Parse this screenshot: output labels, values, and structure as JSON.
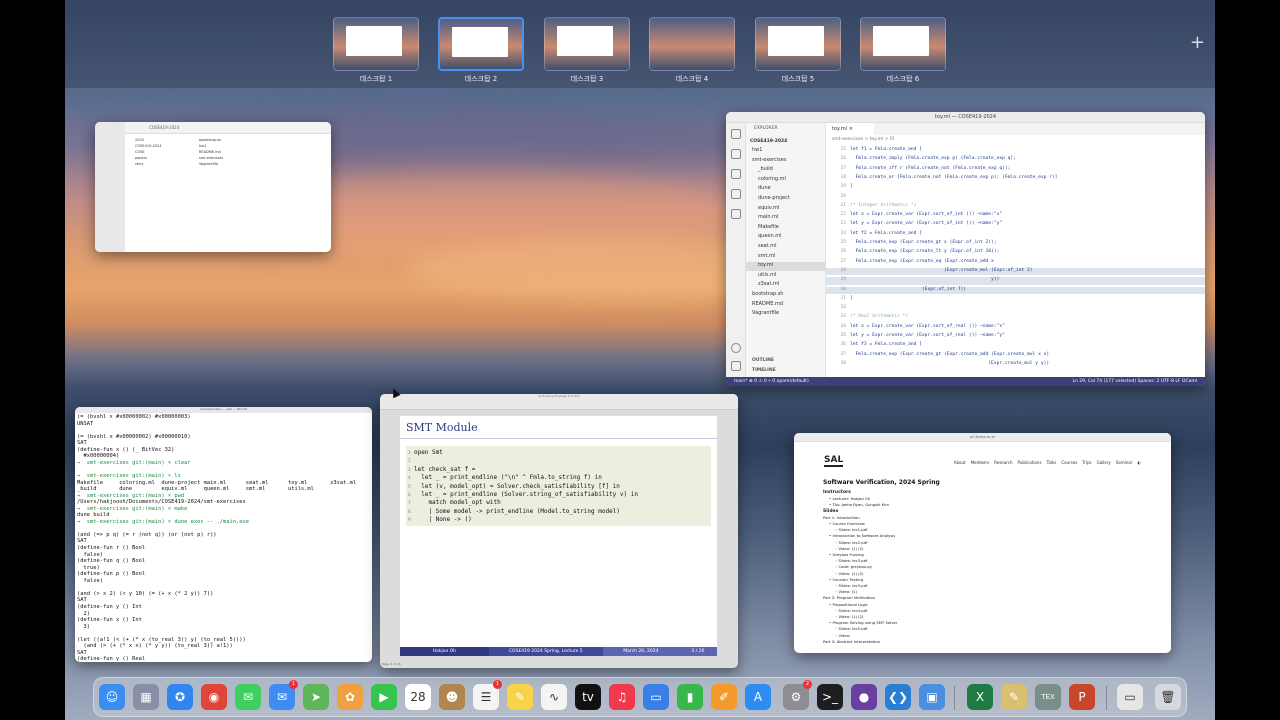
{
  "spaces": [
    {
      "label": "데스크탑 1",
      "active": false
    },
    {
      "label": "데스크탑 2",
      "active": true
    },
    {
      "label": "데스크탑 3",
      "active": false
    },
    {
      "label": "데스크탑 4",
      "active": false
    },
    {
      "label": "데스크탑 5",
      "active": false
    },
    {
      "label": "데스크탑 6",
      "active": false
    }
  ],
  "add_space": "+",
  "finder": {
    "title": "COSE419-2024",
    "items_left": [
      "2024",
      "COSE419-2024",
      "COSE",
      "papers",
      "retry"
    ],
    "items_right": [
      "bootstrap.sh",
      "hw1",
      "README.md",
      "smt-exercises",
      "Vagrantfile"
    ]
  },
  "vscode": {
    "title": "toy.ml — COSE419-2024",
    "explorer_header": "EXPLORER",
    "root": "COSE419-2024",
    "tree": [
      "hw1",
      "smt-exercises",
      "_build",
      "coloring.ml",
      "dune",
      "dune-project",
      "equiv.ml",
      "main.ml",
      "Makefile",
      "queen.ml",
      "seat.ml",
      "smt.ml",
      "toy.ml",
      "utils.ml",
      "z3sat.ml",
      "bootstrap.sh",
      "README.md",
      "Vagrantfile"
    ],
    "tab": "toy.ml",
    "crumb": "smt-exercises > toy.ml > f2",
    "outline": "OUTLINE",
    "timeline": "TIMELINE",
    "code": [
      {
        "n": "15",
        "t": "let f1 = Fmla.create_and [",
        "c": false,
        "h": false
      },
      {
        "n": "16",
        "t": "  Fmla.create_imply (Fmla.create_exp p) (Fmla.create_exp q);",
        "c": false,
        "h": false
      },
      {
        "n": "17",
        "t": "  Fmla.create_iff r (Fmla.create_not (Fmla.create_exp q));",
        "c": false,
        "h": false
      },
      {
        "n": "18",
        "t": "  Fmla.create_or [Fmla.create_not (Fmla.create_exp p); (Fmla.create_exp r)]",
        "c": false,
        "h": false
      },
      {
        "n": "19",
        "t": "]",
        "c": false,
        "h": false
      },
      {
        "n": "20",
        "t": "",
        "c": false,
        "h": false
      },
      {
        "n": "21",
        "t": "(* Integer Arithmetic *)",
        "c": true,
        "h": false
      },
      {
        "n": "22",
        "t": "let x = Expr.create_var (Expr.sort_of_int ()) ~name:\"x\"",
        "c": false,
        "h": false
      },
      {
        "n": "23",
        "t": "let y = Expr.create_var (Expr.sort_of_int ()) ~name:\"y\"",
        "c": false,
        "h": false
      },
      {
        "n": "24",
        "t": "let f2 = Fmla.create_and [",
        "c": false,
        "h": false
      },
      {
        "n": "25",
        "t": "  Fmla.create_exp (Expr.create_gt x (Expr.of_int 2));",
        "c": false,
        "h": false
      },
      {
        "n": "26",
        "t": "  Fmla.create_exp (Expr.create_lt y (Expr.of_int 10));",
        "c": false,
        "h": false
      },
      {
        "n": "27",
        "t": "  Fmla.create_exp (Expr.create_eq (Expr.create_add x",
        "c": false,
        "h": false
      },
      {
        "n": "28",
        "t": "                                  (Expr.create_mul (Expr.of_int 2)",
        "c": false,
        "h": true
      },
      {
        "n": "29",
        "t": "                                                   y))",
        "c": false,
        "h": true
      },
      {
        "n": "30",
        "t": "                          (Expr.of_int 7))",
        "c": false,
        "h": true
      },
      {
        "n": "31",
        "t": "]",
        "c": false,
        "h": false
      },
      {
        "n": "32",
        "t": "",
        "c": false,
        "h": false
      },
      {
        "n": "33",
        "t": "(* Real Arithmetic *)",
        "c": true,
        "h": false
      },
      {
        "n": "34",
        "t": "let x = Expr.create_var (Expr.sort_of_real ()) ~name:\"x\"",
        "c": false,
        "h": false
      },
      {
        "n": "35",
        "t": "let y = Expr.create_var (Expr.sort_of_real ()) ~name:\"y\"",
        "c": false,
        "h": false
      },
      {
        "n": "36",
        "t": "let f3 = Fmla.create_and [",
        "c": false,
        "h": false
      },
      {
        "n": "37",
        "t": "  Fmla.create_exp (Expr.create_gt (Expr.create_add (Expr.create_mul x x)",
        "c": false,
        "h": false
      },
      {
        "n": "38",
        "t": "                                                  (Expr.create_mul y y))",
        "c": false,
        "h": false
      }
    ],
    "status_left": "main*   ⊗ 0 ⚠ 0   ⑂ 0   opam(default)",
    "status_right": "Ln 29, Col 74 (177 selected)   Spaces: 2   UTF-8   LF   OCaml"
  },
  "terminal": {
    "title": "smt-exercises — -zsh — 80×24",
    "lines": [
      {
        "t": "(= (bvshl x #x00000002) #x00000003)",
        "p": false
      },
      {
        "t": "UNSAT",
        "p": false
      },
      {
        "t": "",
        "p": false
      },
      {
        "t": "(= (bvshl x #x00000002) #x00000010)",
        "p": false
      },
      {
        "t": "SAT",
        "p": false
      },
      {
        "t": "(define-fun x () (_ BitVec 32)",
        "p": false
      },
      {
        "t": "  #x00000004)",
        "p": false
      },
      {
        "t": "→  smt-exercises git:(main) × clear",
        "p": true
      },
      {
        "t": "",
        "p": false
      },
      {
        "t": "→  smt-exercises git:(main) × ls",
        "p": true
      },
      {
        "t": "Makefile     coloring.ml  dune-project main.ml      seat.ml      toy.ml       z3sat.ml",
        "p": false
      },
      {
        "t": "_build       dune         equiv.ml     queen.ml     smt.ml       utils.ml",
        "p": false
      },
      {
        "t": "→  smt-exercises git:(main) × pwd",
        "p": true
      },
      {
        "t": "/Users/hakjoooh/Documents/COSE419-2024/smt-exercises",
        "p": false
      },
      {
        "t": "→  smt-exercises git:(main) × make",
        "p": true
      },
      {
        "t": "dune build",
        "p": false
      },
      {
        "t": "→  smt-exercises git:(main) × dune exec -- ./main.exe",
        "p": true
      },
      {
        "t": "",
        "p": false
      },
      {
        "t": "(and (=> p q) (= r (not q)) (or (not p) r))",
        "p": false
      },
      {
        "t": "SAT",
        "p": false
      },
      {
        "t": "(define-fun r () Bool",
        "p": false
      },
      {
        "t": "  false)",
        "p": false
      },
      {
        "t": "(define-fun q () Bool",
        "p": false
      },
      {
        "t": "  true)",
        "p": false
      },
      {
        "t": "(define-fun p () Bool",
        "p": false
      },
      {
        "t": "  false)",
        "p": false
      },
      {
        "t": "",
        "p": false
      },
      {
        "t": "(and (> x 2) (< y 10) (= (+ x (* 2 y)) 7))",
        "p": false
      },
      {
        "t": "SAT",
        "p": false
      },
      {
        "t": "(define-fun y () Int",
        "p": false
      },
      {
        "t": "  2)",
        "p": false
      },
      {
        "t": "(define-fun x () Int",
        "p": false
      },
      {
        "t": "  3)",
        "p": false
      },
      {
        "t": "",
        "p": false
      },
      {
        "t": "(let ((a!1 (< (+ (* x (to_real 3)) y) (to_real 5))))",
        "p": false
      },
      {
        "t": "  (and (> (+ (* x x) (* y y)) (to_real 3)) a!1))",
        "p": false
      },
      {
        "t": "SAT",
        "p": false
      },
      {
        "t": "(define-fun y () Real",
        "p": false
      }
    ]
  },
  "preview": {
    "title": "lec5-smt.pdf (page 3 of 26)",
    "slide_title": "SMT Module",
    "code": [
      {
        "n": "1",
        "t": "open Smt"
      },
      {
        "n": "2",
        "t": ""
      },
      {
        "n": "3",
        "t": "let check_sat f ="
      },
      {
        "n": "4",
        "t": "  let _ = print_endline (\"\\n\" ^ Fmla.to_string f) in"
      },
      {
        "n": "5",
        "t": "  let (v, model_opt) = Solver.check_satisfiability [f] in"
      },
      {
        "n": "6",
        "t": "  let _ = print_endline (Solver.string_of_satisfiability v) in"
      },
      {
        "n": "7",
        "t": "    match model_opt with"
      },
      {
        "n": "8",
        "t": "    | Some model -> print_endline (Model.to_string model)"
      },
      {
        "n": "9",
        "t": "    | None -> ()"
      }
    ],
    "footer": [
      "Hakjoo Oh",
      "COSE419 2024 Spring, Lecture 5",
      "March 26, 2024",
      "3 / 26"
    ],
    "page_info": "Page 3 of 26"
  },
  "safari": {
    "url": "prl.korea.ac.kr",
    "logo": "SAL",
    "nav": [
      "About",
      "Members",
      "Research",
      "Publications",
      "Talks",
      "Courses",
      "Trips",
      "Gallery",
      "Seminar",
      "◐"
    ],
    "heading": "Software Verification, 2024 Spring",
    "lines": [
      {
        "t": "Instructors",
        "b": true,
        "i": 0
      },
      {
        "t": "• Lecturer: Hakjoo Oh",
        "b": false,
        "i": 1
      },
      {
        "t": "• TAs: Jaeho Ryan, Gungsik Kim",
        "b": false,
        "i": 1
      },
      {
        "t": "Slides",
        "b": true,
        "i": 0
      },
      {
        "t": "Part 1: Introduction",
        "b": false,
        "i": 0
      },
      {
        "t": "• Course Overview",
        "b": false,
        "i": 1
      },
      {
        "t": "◦ Slides: lec1.pdf",
        "b": false,
        "i": 2
      },
      {
        "t": "• Introduction to Software Analysis",
        "b": false,
        "i": 1
      },
      {
        "t": "◦ Slides: lec2.pdf",
        "b": false,
        "i": 2
      },
      {
        "t": "◦ Video: (1) (2)",
        "b": false,
        "i": 2
      },
      {
        "t": "• Greybox Fuzzing",
        "b": false,
        "i": 1
      },
      {
        "t": "◦ Slides: lec3.pdf",
        "b": false,
        "i": 2
      },
      {
        "t": "◦ Code: greybox.py",
        "b": false,
        "i": 2
      },
      {
        "t": "◦ Video: (1) (2)",
        "b": false,
        "i": 2
      },
      {
        "t": "• Concolic Testing",
        "b": false,
        "i": 1
      },
      {
        "t": "◦ Slides: lec3.pdf",
        "b": false,
        "i": 2
      },
      {
        "t": "◦ Video: (1)",
        "b": false,
        "i": 2
      },
      {
        "t": "Part 2: Program Verification",
        "b": false,
        "i": 0
      },
      {
        "t": "• Propositional Logic",
        "b": false,
        "i": 1
      },
      {
        "t": "◦ Slides: lec4.pdf",
        "b": false,
        "i": 2
      },
      {
        "t": "◦ Video: (1) (2)",
        "b": false,
        "i": 2
      },
      {
        "t": "• Program Solving using SMT Solver",
        "b": false,
        "i": 1
      },
      {
        "t": "◦ Slides: lec5.pdf",
        "b": false,
        "i": 2
      },
      {
        "t": "◦ Video:",
        "b": false,
        "i": 2
      },
      {
        "t": "Part 3: Abstract Interpretation",
        "b": false,
        "i": 0
      }
    ]
  },
  "dock": [
    {
      "name": "finder",
      "glyph": "☺",
      "color": "#3a8ef0",
      "badge": ""
    },
    {
      "name": "launchpad",
      "glyph": "▦",
      "color": "#8a8fa8",
      "badge": ""
    },
    {
      "name": "safari",
      "glyph": "✪",
      "color": "#2f86f0",
      "badge": ""
    },
    {
      "name": "chrome",
      "glyph": "◉",
      "color": "#e0453a",
      "badge": ""
    },
    {
      "name": "messages",
      "glyph": "✉",
      "color": "#3ecf5e",
      "badge": ""
    },
    {
      "name": "mail",
      "glyph": "✉",
      "color": "#3d8df2",
      "badge": "1"
    },
    {
      "name": "maps",
      "glyph": "➤",
      "color": "#5db65a",
      "badge": ""
    },
    {
      "name": "photos",
      "glyph": "✿",
      "color": "#f0a040",
      "badge": ""
    },
    {
      "name": "facetime",
      "glyph": "▶",
      "color": "#37c44e",
      "badge": ""
    },
    {
      "name": "calendar",
      "glyph": "28",
      "color": "#ffffff",
      "badge": ""
    },
    {
      "name": "contacts",
      "glyph": "☻",
      "color": "#b0864e",
      "badge": ""
    },
    {
      "name": "reminders",
      "glyph": "☰",
      "color": "#f4f4f4",
      "badge": "1"
    },
    {
      "name": "notes",
      "glyph": "✎",
      "color": "#f7d34a",
      "badge": ""
    },
    {
      "name": "freeform",
      "glyph": "∿",
      "color": "#f4f4f4",
      "badge": ""
    },
    {
      "name": "tv",
      "glyph": "tv",
      "color": "#111111",
      "badge": ""
    },
    {
      "name": "music",
      "glyph": "♫",
      "color": "#f2384c",
      "badge": ""
    },
    {
      "name": "keynote",
      "glyph": "▭",
      "color": "#3a7fe8",
      "badge": ""
    },
    {
      "name": "numbers",
      "glyph": "▮",
      "color": "#36b84a",
      "badge": ""
    },
    {
      "name": "pages",
      "glyph": "✐",
      "color": "#f49a2c",
      "badge": ""
    },
    {
      "name": "app-store",
      "glyph": "A",
      "color": "#2c8cf2",
      "badge": ""
    },
    {
      "name": "system-settings",
      "glyph": "⚙",
      "color": "#8d8d93",
      "badge": "2"
    },
    {
      "name": "terminal",
      "glyph": ">_",
      "color": "#1e1e1e",
      "badge": ""
    },
    {
      "name": "github-desktop",
      "glyph": "●",
      "color": "#6b3fa0",
      "badge": ""
    },
    {
      "name": "vscode",
      "glyph": "❮❯",
      "color": "#2a7fd4",
      "badge": ""
    },
    {
      "name": "preview",
      "glyph": "▣",
      "color": "#4a8fe0",
      "badge": ""
    },
    {
      "name": "excel",
      "glyph": "X",
      "color": "#1f7a43",
      "badge": ""
    },
    {
      "name": "script-editor",
      "glyph": "✎",
      "color": "#d8c070",
      "badge": ""
    },
    {
      "name": "texshop",
      "glyph": "TEX",
      "color": "#7a8f8a",
      "badge": ""
    },
    {
      "name": "powerpoint",
      "glyph": "P",
      "color": "#c8462c",
      "badge": ""
    },
    {
      "name": "downloads-stack",
      "glyph": "▭",
      "color": "#e6e6e6",
      "badge": ""
    },
    {
      "name": "trash",
      "glyph": "🗑",
      "color": "#d5d8de",
      "badge": ""
    }
  ]
}
